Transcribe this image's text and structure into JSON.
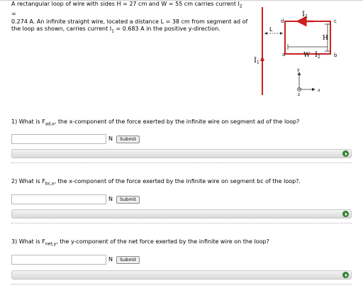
{
  "problem": {
    "text_line1": "A rectangular loop of wire with sides H = 27 cm and W = 55 cm carries current I",
    "text_line1_sub": "2",
    "text_line1_end": " =",
    "text_line2": "0.274 A. An infinite straight wire, located a distance L = 38 cm from segment ad of",
    "text_line3a": "the loop as shown, carries current I",
    "text_line3_sub": "1",
    "text_line3b": " = 0.683 A in the positive y-direction."
  },
  "diagram": {
    "labels": {
      "I2_top": "I",
      "I2_top_sub": "2",
      "d": "d",
      "c": "c",
      "L": "L",
      "H": "H",
      "a": "a",
      "W": "W",
      "I2_bottom": "I",
      "I2_bottom_sub": "2",
      "b": "b",
      "I1": "I",
      "I1_sub": "1",
      "y": "y",
      "z": "z",
      "x": "x"
    },
    "colors": {
      "wire": "#cc1f1f",
      "loop": "#cc1f1f",
      "axes": "#333333"
    }
  },
  "questions": [
    {
      "number": "1)",
      "text_pre": "What is F",
      "sub": "ad,x",
      "text_post": ", the x-component of the force exerted by the infinite wire on segment ad of the loop?",
      "unit": "N",
      "submit_label": "Submit"
    },
    {
      "number": "2)",
      "text_pre": "What is F",
      "sub": "bc,x",
      "text_post": ", the x-component of the force exerted by the infinite wire on segment bc of the loop?.",
      "unit": "N",
      "submit_label": "Submit"
    },
    {
      "number": "3)",
      "text_pre": "What is F",
      "sub": "net,y",
      "text_post": ", the y-component of the net force exerted by the infinite wire on the loop?",
      "unit": "N",
      "submit_label": "Submit"
    }
  ]
}
